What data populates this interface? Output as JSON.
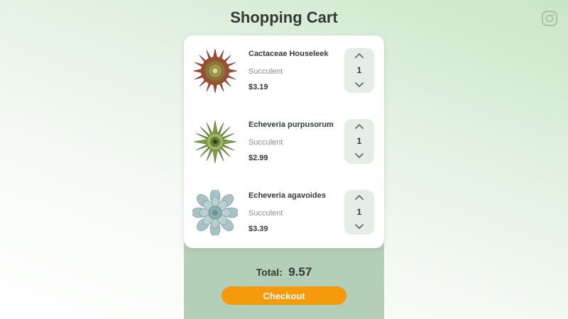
{
  "header": {
    "title": "Shopping Cart",
    "social_icon": "instagram-icon"
  },
  "cart": {
    "items": [
      {
        "name": "Cactaceae Houseleek",
        "category": "Succulent",
        "price": "$3.19",
        "quantity": "1",
        "image": "succulent-rosette-red-green"
      },
      {
        "name": "Echeveria purpusorum",
        "category": "Succulent",
        "price": "$2.99",
        "quantity": "1",
        "image": "succulent-rosette-green-spiky"
      },
      {
        "name": "Echeveria agavoides",
        "category": "Succulent",
        "price": "$3.39",
        "quantity": "1",
        "image": "succulent-rosette-blue-gray"
      }
    ]
  },
  "summary": {
    "total_label": "Total:",
    "total_value": "9.57",
    "checkout_label": "Checkout"
  },
  "colors": {
    "accent": "#f49a0b",
    "summary_panel": "#b4cfb8",
    "stepper_bg": "#e6ede6",
    "text": "#333a33"
  }
}
